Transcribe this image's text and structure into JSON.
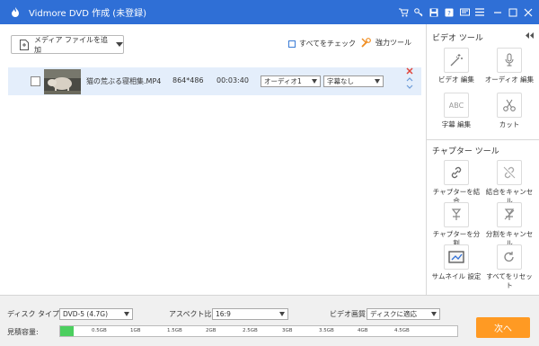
{
  "titlebar": {
    "title": "Vidmore DVD 作成 (未登録)",
    "icons": [
      "cart-icon",
      "key-icon",
      "save-icon",
      "question-icon",
      "feedback-icon",
      "menu-icon",
      "minimize-icon",
      "maximize-icon",
      "close-icon"
    ],
    "bg_color": "#2f6fd6"
  },
  "toolbar": {
    "add_media_label": "メディア ファイルを追加",
    "check_all_label": "すべてをチェック",
    "power_tools_label": "強力ツール"
  },
  "file_row": {
    "checked": false,
    "filename": "猫の荒ぶる寝相集.MP4",
    "resolution": "864*486",
    "duration": "00:03:40",
    "audio_track": "オーディオ1",
    "subtitle": "字幕なし"
  },
  "sidebar": {
    "video_tools_title": "ビデオ ツール",
    "video_tools": [
      {
        "label": "ビデオ 編集",
        "icon": "magic-wand-icon"
      },
      {
        "label": "オーディオ 編集",
        "icon": "microphone-icon"
      },
      {
        "label": "字幕 編集",
        "icon": "abc-subtitle-icon"
      },
      {
        "label": "カット",
        "icon": "scissors-icon"
      }
    ],
    "chapter_tools_title": "チャプター ツール",
    "chapter_tools": [
      {
        "label": "チャプターを結合",
        "icon": "link-icon"
      },
      {
        "label": "結合をキャンセル",
        "icon": "unlink-icon"
      },
      {
        "label": "チャプターを分割",
        "icon": "split-icon"
      },
      {
        "label": "分割をキャンセル",
        "icon": "cancel-split-icon"
      },
      {
        "label": "サムネイル 設定",
        "icon": "thumbnail-icon"
      },
      {
        "label": "すべてをリセット",
        "icon": "reset-icon"
      }
    ]
  },
  "bottom": {
    "disc_type_label": "ディスク タイプ",
    "disc_type_value": "DVD-5 (4.7G)",
    "aspect_label": "アスペクト比:",
    "aspect_value": "16:9",
    "quality_label": "ビデオ画質:",
    "quality_value": "ディスクに適応",
    "capacity_label": "見積容量:",
    "capacity_ticks": [
      "0.5GB",
      "1GB",
      "1.5GB",
      "2GB",
      "2.5GB",
      "3GB",
      "3.5GB",
      "4GB",
      "4.5GB"
    ],
    "capacity_used_fraction": 0.035,
    "next_label": "次へ",
    "accent_color": "#ff9a23"
  }
}
